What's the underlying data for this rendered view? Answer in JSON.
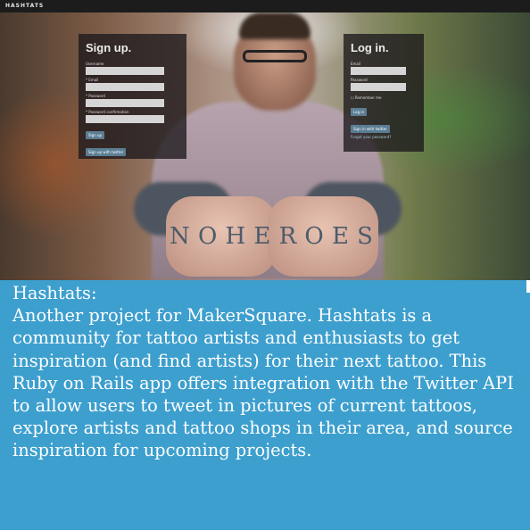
{
  "topbar": {
    "brand": "HASHTATS"
  },
  "hero": {
    "knuckle_tattoo": [
      "N",
      "O",
      "H",
      "E",
      "R",
      "O",
      "E",
      "S"
    ]
  },
  "signup": {
    "title": "Sign up.",
    "username_label": "Username",
    "email_label": "* Email",
    "password_label": "* Password",
    "confirm_label": "* Password confirmation",
    "submit_label": "Sign up",
    "twitter_label": "Sign up with twitter"
  },
  "login": {
    "title": "Log in.",
    "email_label": "Email",
    "password_label": "Password",
    "remember_label": "Remember me",
    "submit_label": "Log in",
    "twitter_label": "Sign in with twitter",
    "forgot_label": "Forgot your password?"
  },
  "caption": {
    "heading": "Hashtats:",
    "body": "Another project for MakerSquare. Hashtats is a community for tattoo artists and enthusiasts to get inspiration (and find artists) for their next tattoo. This Ruby on Rails app offers integration with the Twitter API to allow users to tweet in pictures of current tattoos, explore artists and tattoo shops in their area, and source inspiration for upcoming projects."
  },
  "colors": {
    "caption_bg": "#3d9fce",
    "topbar_bg": "#1c1c1c",
    "button": "#5b7d93"
  }
}
